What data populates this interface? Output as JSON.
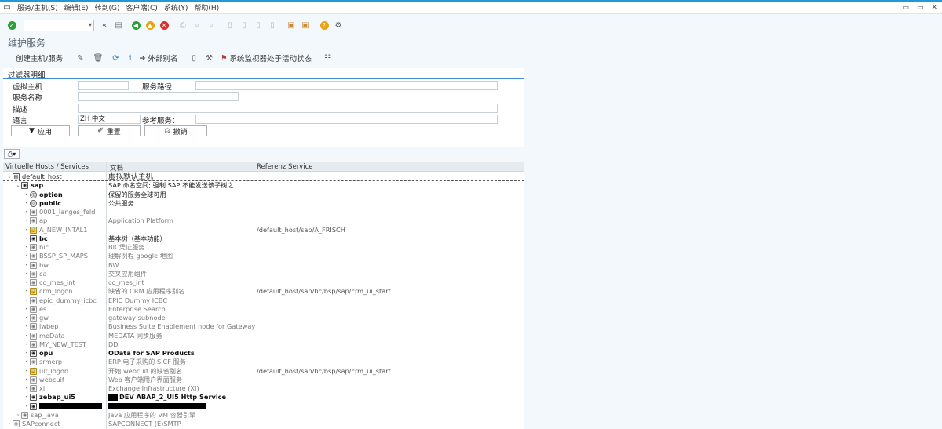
{
  "menu": [
    "服务/主机(S)",
    "编辑(E)",
    "转到(G)",
    "客户端(C)",
    "系统(Y)",
    "帮助(H)"
  ],
  "window_controls": [
    "▭",
    "▭",
    "✕"
  ],
  "page_title": "维护服务",
  "app_toolbar": {
    "create": "创建主机/服务",
    "external_alias": "外部别名",
    "system_monitor": "系统监视器处于活动状态"
  },
  "filter": {
    "title": "过滤器明细",
    "virtual_host_label": "虚拟主机",
    "service_path_label": "服务路径",
    "service_name_label": "服务名称",
    "description_label": "描述",
    "language_label": "语言",
    "language_value": "ZH 中文",
    "ref_service_label": "参考服务：",
    "apply": "应用",
    "reset": "重置",
    "cancel": "撤销"
  },
  "tree": {
    "headers": [
      "Virtuelle Hosts / Services",
      "文档",
      "Referenz Service"
    ],
    "rows": [
      {
        "depth": 0,
        "arrow": "⌄",
        "icon": "file",
        "name": "default_host",
        "doc": "虚拟默认主机",
        "ref": "",
        "style": "normal",
        "docstyle": "big"
      },
      {
        "depth": 1,
        "arrow": "⌄",
        "icon": "node",
        "name": "sap",
        "doc": "SAP 命名空间; 强制 SAP 不能发送该子树之...",
        "ref": "",
        "style": "bold",
        "docstyle": "normal"
      },
      {
        "depth": 2,
        "arrow": "•",
        "icon": "circle",
        "name": "option",
        "doc": "保留的服务全球可用",
        "ref": "",
        "style": "bold",
        "docstyle": "normal"
      },
      {
        "depth": 2,
        "arrow": "•",
        "icon": "circle",
        "name": "public",
        "doc": "公共服务",
        "ref": "",
        "style": "bold",
        "docstyle": "normal"
      },
      {
        "depth": 2,
        "arrow": "•",
        "icon": "gray",
        "name": "0001_langes_feld",
        "doc": "",
        "ref": "",
        "style": "dim",
        "docstyle": "dim"
      },
      {
        "depth": 2,
        "arrow": "•",
        "icon": "gray",
        "name": "ap",
        "doc": "Application Platform",
        "ref": "",
        "style": "dim",
        "docstyle": "dim"
      },
      {
        "depth": 2,
        "arrow": "•",
        "icon": "lock",
        "name": "A_NEW_INTAL1",
        "doc": "",
        "ref": "/default_host/sap/A_FRISCH",
        "style": "dim",
        "docstyle": "dim"
      },
      {
        "depth": 2,
        "arrow": "•",
        "icon": "node",
        "name": "bc",
        "doc": "基本树（基本功能）",
        "ref": "",
        "style": "bold",
        "docstyle": "normal"
      },
      {
        "depth": 2,
        "arrow": "•",
        "icon": "gray",
        "name": "bic",
        "doc": "BIC凭证服务",
        "ref": "",
        "style": "dim",
        "docstyle": "dim"
      },
      {
        "depth": 2,
        "arrow": "•",
        "icon": "gray",
        "name": "BSSP_SP_MAPS",
        "doc": "理解例程 google 地图",
        "ref": "",
        "style": "dim",
        "docstyle": "dim"
      },
      {
        "depth": 2,
        "arrow": "•",
        "icon": "gray",
        "name": "bw",
        "doc": "BW",
        "ref": "",
        "style": "dim",
        "docstyle": "dim"
      },
      {
        "depth": 2,
        "arrow": "•",
        "icon": "gray",
        "name": "ca",
        "doc": "交叉应用组件",
        "ref": "",
        "style": "dim",
        "docstyle": "dim"
      },
      {
        "depth": 2,
        "arrow": "•",
        "icon": "gray",
        "name": "co_mes_int",
        "doc": "co_mes_int",
        "ref": "",
        "style": "dim",
        "docstyle": "dim"
      },
      {
        "depth": 2,
        "arrow": "•",
        "icon": "lock",
        "name": "crm_logon",
        "doc": "缺省的 CRM 应用程序别名",
        "ref": "/default_host/sap/bc/bsp/sap/crm_ui_start",
        "style": "dim",
        "docstyle": "dim"
      },
      {
        "depth": 2,
        "arrow": "•",
        "icon": "gray",
        "name": "epic_dummy_icbc",
        "doc": "EPIC Dummy ICBC",
        "ref": "",
        "style": "dim",
        "docstyle": "dim"
      },
      {
        "depth": 2,
        "arrow": "•",
        "icon": "gray",
        "name": "es",
        "doc": "Enterprise Search",
        "ref": "",
        "style": "dim",
        "docstyle": "dim"
      },
      {
        "depth": 2,
        "arrow": "•",
        "icon": "gray",
        "name": "gw",
        "doc": "gateway subnode",
        "ref": "",
        "style": "dim",
        "docstyle": "dim"
      },
      {
        "depth": 2,
        "arrow": "•",
        "icon": "gray",
        "name": "iwbep",
        "doc": "Business Suite Enablement node for Gateway",
        "ref": "",
        "style": "dim",
        "docstyle": "dim"
      },
      {
        "depth": 2,
        "arrow": "•",
        "icon": "gray",
        "name": "meData",
        "doc": "MEDATA 同步服务",
        "ref": "",
        "style": "dim",
        "docstyle": "dim"
      },
      {
        "depth": 2,
        "arrow": "•",
        "icon": "gray",
        "name": "MY_NEW_TEST",
        "doc": "DD",
        "ref": "",
        "style": "dim",
        "docstyle": "dim"
      },
      {
        "depth": 2,
        "arrow": "•",
        "icon": "node",
        "name": "opu",
        "doc": "OData for SAP Products",
        "ref": "",
        "style": "bold",
        "docstyle": "bold"
      },
      {
        "depth": 2,
        "arrow": "•",
        "icon": "gray",
        "name": "srmerp",
        "doc": "ERP 电子采购的 SICF 服务",
        "ref": "",
        "style": "dim",
        "docstyle": "dim"
      },
      {
        "depth": 2,
        "arrow": "•",
        "icon": "lock",
        "name": "uif_logon",
        "doc": "开始 webcuif 的缺省别名",
        "ref": "/default_host/sap/bc/bsp/sap/crm_ui_start",
        "style": "dim",
        "docstyle": "dim"
      },
      {
        "depth": 2,
        "arrow": "•",
        "icon": "gray",
        "name": "webcuif",
        "doc": "Web 客户端用户界面服务",
        "ref": "",
        "style": "dim",
        "docstyle": "dim"
      },
      {
        "depth": 2,
        "arrow": "•",
        "icon": "gray",
        "name": "xi",
        "doc": "Exchange Infrastructure (XI)",
        "ref": "",
        "style": "dim",
        "docstyle": "dim"
      },
      {
        "depth": 2,
        "arrow": "•",
        "icon": "node",
        "name": "zebap_ui5",
        "doc": "DEV ABAP_2_UI5 Http Service",
        "ref": "",
        "style": "bold",
        "docstyle": "bold"
      },
      {
        "depth": 2,
        "arrow": "•",
        "icon": "node",
        "name": "",
        "doc": "",
        "ref": "",
        "style": "bold",
        "docstyle": "bold"
      },
      {
        "depth": 1,
        "arrow": "›",
        "icon": "gray",
        "name": "sap_java",
        "doc": "Java 应用程序的 VM 容器引擎",
        "ref": "",
        "style": "dim",
        "docstyle": "dim"
      },
      {
        "depth": 0,
        "arrow": "›",
        "icon": "gray",
        "name": "SAPconnect",
        "doc": "SAPCONNECT (E)SMTP",
        "ref": "",
        "style": "dim",
        "docstyle": "dim"
      }
    ]
  }
}
